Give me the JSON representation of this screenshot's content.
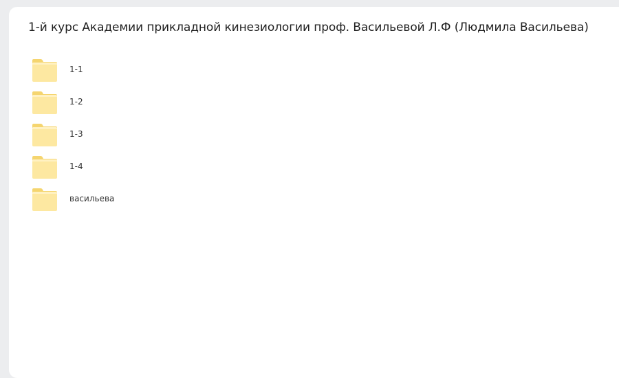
{
  "page": {
    "title": "1-й курс Академии прикладной кинезиологии проф. Васильевой Л.Ф (Людмила Васильева)"
  },
  "folders": [
    {
      "name": "1-1",
      "icon": "folder-icon"
    },
    {
      "name": "1-2",
      "icon": "folder-icon"
    },
    {
      "name": "1-3",
      "icon": "folder-icon"
    },
    {
      "name": "1-4",
      "icon": "folder-icon"
    },
    {
      "name": "васильева",
      "icon": "folder-icon"
    }
  ],
  "colors": {
    "background": "#ecedef",
    "panel": "#ffffff",
    "folder_front": "#fde99c",
    "folder_back": "#f7d979"
  }
}
